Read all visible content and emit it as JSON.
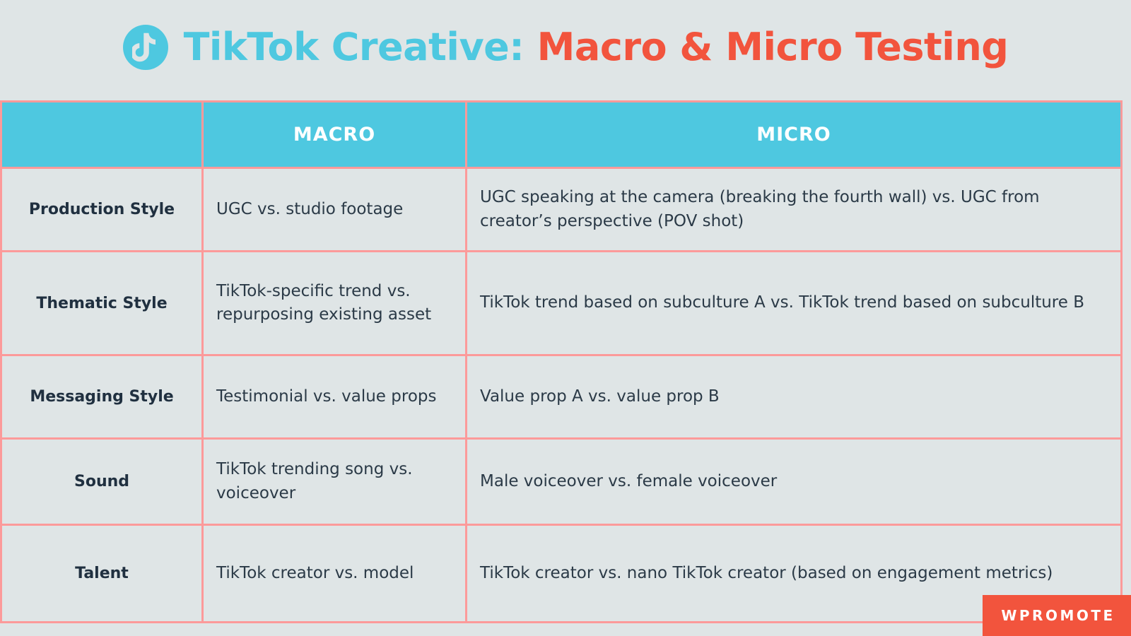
{
  "title": {
    "logo_icon": "tiktok-note-icon",
    "part_cyan": "TikTok Creative:",
    "part_red": "Macro & Micro Testing"
  },
  "colors": {
    "background": "#dfe5e6",
    "cyan": "#4ec8e0",
    "red": "#f2543d",
    "border_pink": "#fc9a9a",
    "text_dark": "#203040",
    "white": "#ffffff"
  },
  "table": {
    "headers": [
      "",
      "MACRO",
      "MICRO"
    ],
    "rows": [
      {
        "label": "Production Style",
        "macro": "UGC vs. studio footage",
        "micro": "UGC speaking at the camera (breaking the fourth wall) vs. UGC from creator’s perspective (POV shot)"
      },
      {
        "label": "Thematic Style",
        "macro": "TikTok-specific trend vs. repurposing existing asset",
        "micro": "TikTok trend based on subculture A vs. TikTok trend based on subculture B"
      },
      {
        "label": "Messaging Style",
        "macro": "Testimonial vs. value props",
        "micro": "Value prop A vs. value prop B"
      },
      {
        "label": "Sound",
        "macro": "TikTok trending song vs. voiceover",
        "micro": "Male voiceover vs. female voiceover"
      },
      {
        "label": "Talent",
        "macro": "TikTok creator vs. model",
        "micro": "TikTok creator vs. nano TikTok creator (based on engagement metrics)"
      }
    ]
  },
  "branding": {
    "logo_text": "WPROMOTE"
  }
}
